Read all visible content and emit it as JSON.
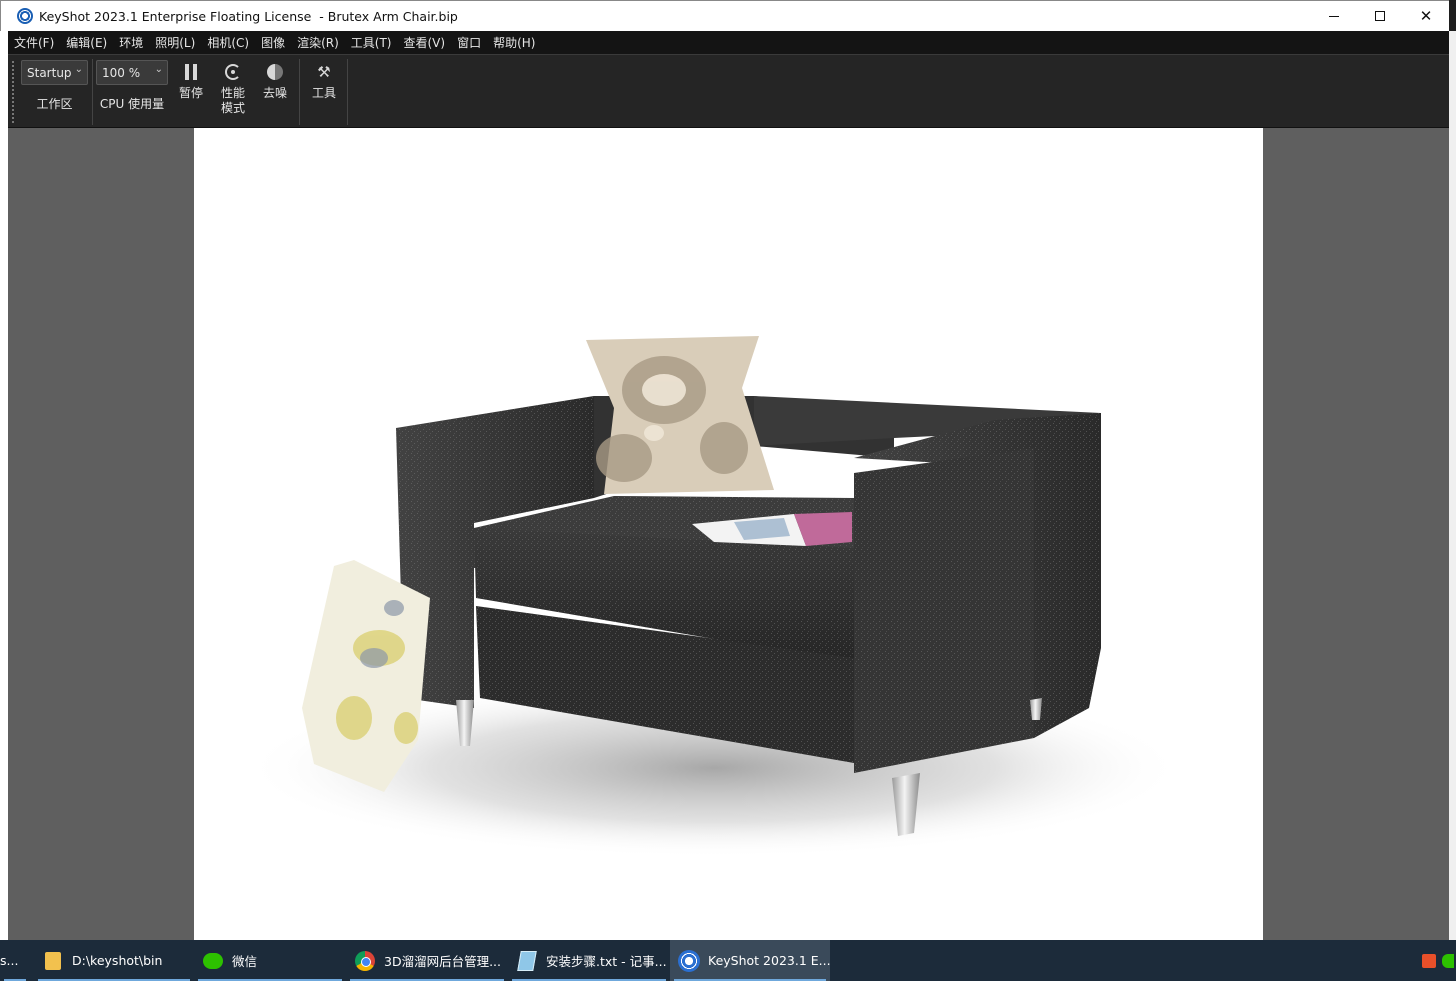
{
  "window": {
    "title": "KeyShot 2023.1 Enterprise Floating License  - Brutex Arm Chair.bip",
    "minimize": "minimize",
    "maximize": "maximize",
    "close": "✕"
  },
  "menu": [
    "文件(F)",
    "编辑(E)",
    "环境",
    "照明(L)",
    "相机(C)",
    "图像",
    "渲染(R)",
    "工具(T)",
    "查看(V)",
    "窗口",
    "帮助(H)"
  ],
  "toolbar": {
    "workspace_value": "Startup",
    "workspace_label": "工作区",
    "cpu_value": "100 %",
    "cpu_label": "CPU 使用量",
    "pause_label": "暂停",
    "performance_label": "性能模式",
    "denoise_label": "去噪",
    "tools_label": "工具"
  },
  "taskbar": {
    "items": [
      {
        "label": "s..."
      },
      {
        "label": "D:\\keyshot\\bin"
      },
      {
        "label": "微信"
      },
      {
        "label": "3D溜溜网后台管理..."
      },
      {
        "label": "安装步骤.txt - 记事..."
      },
      {
        "label": "KeyShot 2023.1 E..."
      }
    ]
  },
  "colors": {
    "accent": "#1a5fb4",
    "menubar": "#141414",
    "toolbar": "#252525",
    "viewport_bg": "#5f5f5f",
    "taskbar": "#1c2b3a"
  }
}
